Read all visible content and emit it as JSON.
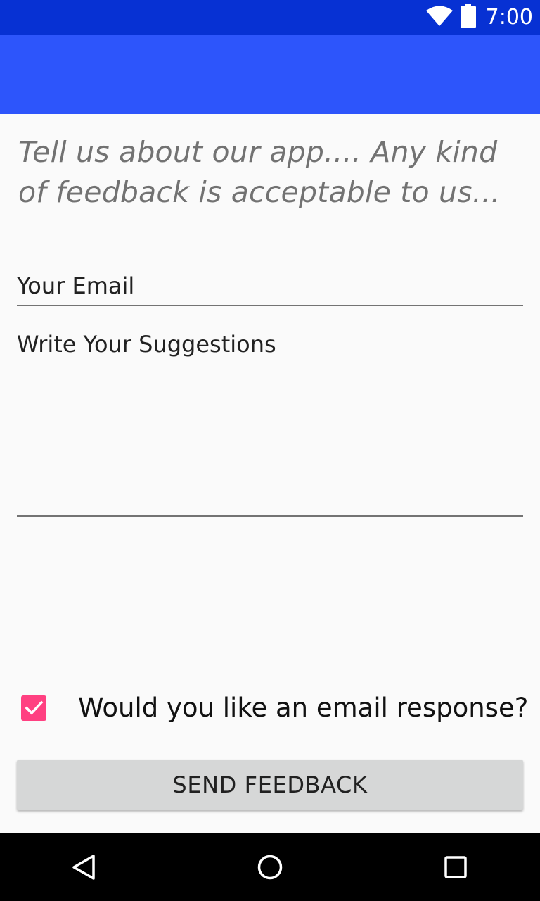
{
  "status_bar": {
    "time": "7:00",
    "icons": [
      "wifi-icon",
      "battery-icon"
    ]
  },
  "app_bar": {
    "title": ""
  },
  "form": {
    "intro_text": "Tell us about our app.... Any kind of feedback is acceptable to us...",
    "email_placeholder": "Your Email",
    "suggestions_placeholder": "Write Your Suggestions",
    "email_response_label": "Would you like an email response?",
    "email_response_checked": true,
    "send_button_label": "SEND FEEDBACK"
  },
  "nav_bar": {
    "icons": [
      "back-icon",
      "home-icon",
      "recents-icon"
    ]
  },
  "colors": {
    "status_bar": "#0731d3",
    "app_bar": "#2d55fb",
    "accent": "#ff4081",
    "background": "#fafafa",
    "button": "#d6d7d7"
  }
}
